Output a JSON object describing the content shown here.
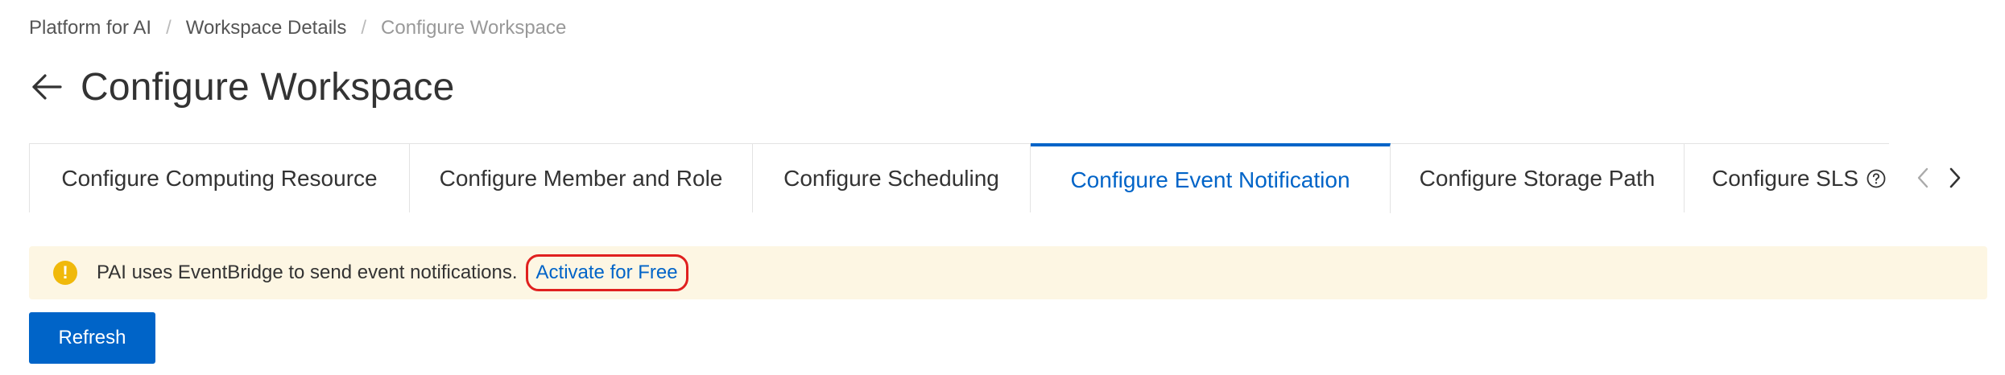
{
  "breadcrumb": {
    "items": [
      "Platform for AI",
      "Workspace Details",
      "Configure Workspace"
    ],
    "separator": "/"
  },
  "page": {
    "title": "Configure Workspace"
  },
  "tabs": {
    "items": [
      {
        "label": "Configure Computing Resource",
        "active": false
      },
      {
        "label": "Configure Member and Role",
        "active": false
      },
      {
        "label": "Configure Scheduling",
        "active": false
      },
      {
        "label": "Configure Event Notification",
        "active": true
      },
      {
        "label": "Configure Storage Path",
        "active": false
      },
      {
        "label": "Configure SLS",
        "active": false
      }
    ]
  },
  "notice": {
    "icon": "warning-icon",
    "text": "PAI uses EventBridge to send event notifications.",
    "link_label": "Activate for Free"
  },
  "actions": {
    "refresh_label": "Refresh"
  },
  "colors": {
    "accent": "#0064c8",
    "notice_bg": "#fdf6e3",
    "warning": "#f0b90b",
    "highlight_outline": "#e0201f"
  }
}
